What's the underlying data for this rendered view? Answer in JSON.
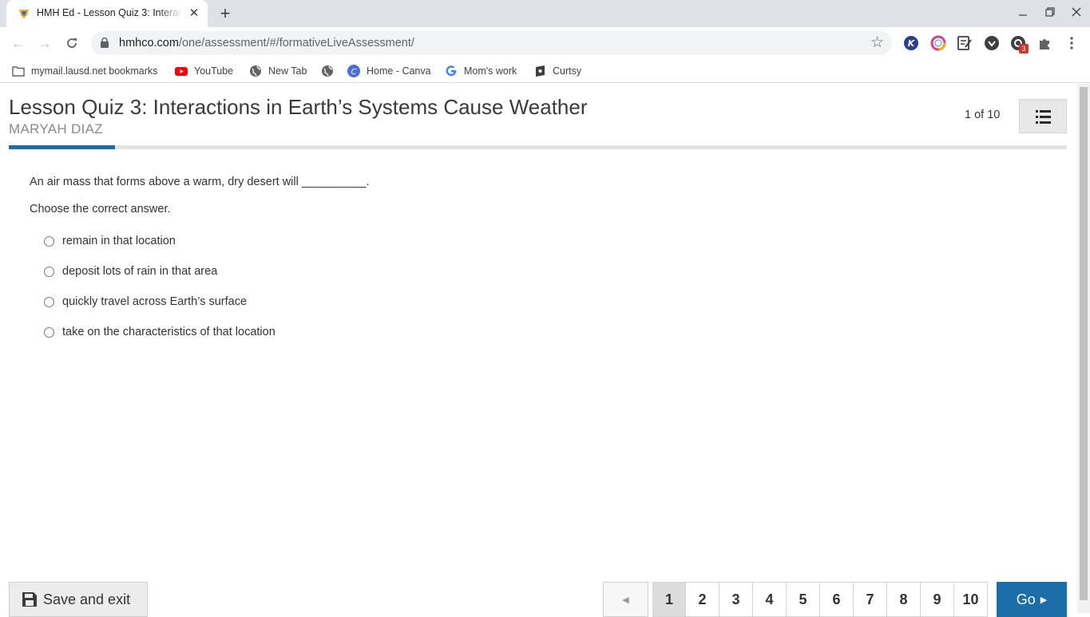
{
  "browser": {
    "tab_title": "HMH Ed - Lesson Quiz 3: Interactions in Earth's Systems Cause Weather",
    "url_host": "hmhco.com",
    "url_path": "/one/assessment/#/formativeLiveAssessment/",
    "extension_badge": "3",
    "bookmarks": [
      {
        "label": "mymail.lausd.net bookmarks",
        "icon": "folder-icon"
      },
      {
        "label": "YouTube",
        "icon": "youtube-icon"
      },
      {
        "label": "New Tab",
        "icon": "globe-icon"
      },
      {
        "label": "",
        "icon": "globe-icon"
      },
      {
        "label": "Home - Canva",
        "icon": "canva-icon"
      },
      {
        "label": "Mom's work",
        "icon": "google-icon"
      },
      {
        "label": "Curtsy",
        "icon": "curtsy-icon"
      }
    ]
  },
  "quiz": {
    "title": "Lesson Quiz 3: Interactions in Earth’s Systems Cause Weather",
    "student": "MARYAH DIAZ",
    "counter": "1 of 10",
    "progress": 0.1,
    "question": "An air mass that forms above a warm, dry desert will __________.",
    "instruction": "Choose the correct answer.",
    "choices": [
      "remain in that location",
      "deposit lots of rain in that area",
      "quickly travel across Earth’s surface",
      "take on the characteristics of that location"
    ]
  },
  "footer": {
    "save_label": "Save and exit",
    "prev_label": "◀",
    "pages": [
      "1",
      "2",
      "3",
      "4",
      "5",
      "6",
      "7",
      "8",
      "9",
      "10"
    ],
    "current_page": "1",
    "go_label": "Go",
    "go_arrow": "▶"
  },
  "colors": {
    "accent": "#1b6ea8",
    "tabstrip": "#dee1e6"
  }
}
